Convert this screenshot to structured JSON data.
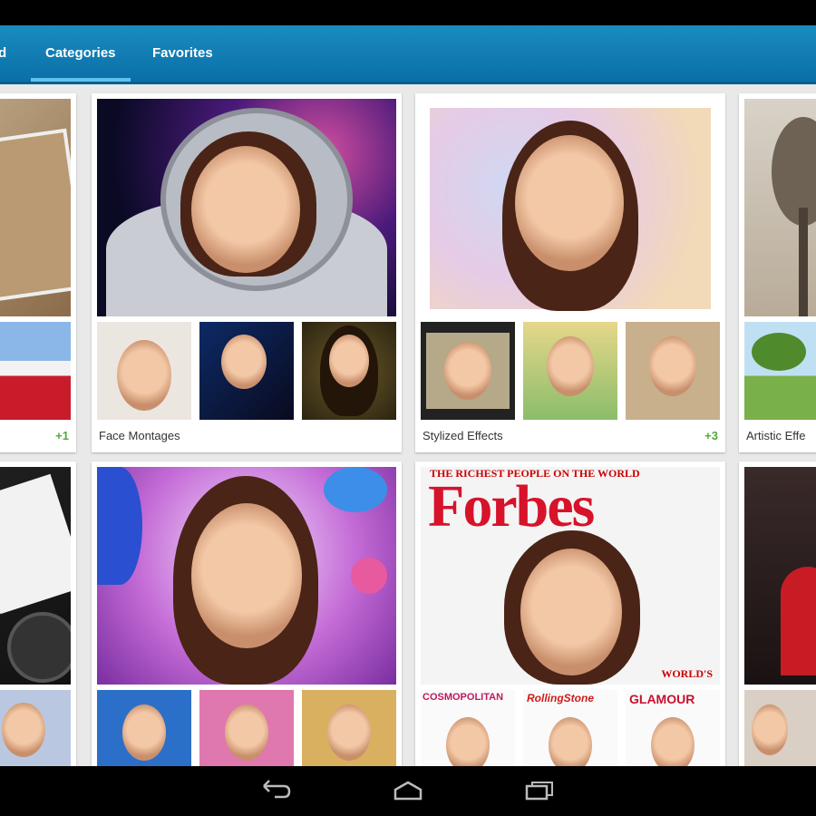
{
  "tabs": [
    {
      "label": "d"
    },
    {
      "label": "Categories"
    },
    {
      "label": "Favorites"
    }
  ],
  "cards": [
    {
      "caption": "",
      "more": "+1"
    },
    {
      "caption": "Face Montages",
      "more": ""
    },
    {
      "caption": "Stylized Effects",
      "more": "+3"
    },
    {
      "caption": "Artistic Effe",
      "more": ""
    }
  ],
  "magazine": {
    "headline": "THE RICHEST PEOPLE ON THE WORLD",
    "title": "Forbes",
    "corner": "WORLD'S",
    "thumbs": [
      "COSMOPOLITAN",
      "RollingStone",
      "GLAMOUR"
    ]
  },
  "navbar": {
    "back_icon": "back-icon",
    "home_icon": "home-icon",
    "recents_icon": "recents-icon"
  },
  "colors": {
    "accent": "#0a6fa6",
    "indicator": "#5fc3ee",
    "plus": "#53a93a"
  }
}
